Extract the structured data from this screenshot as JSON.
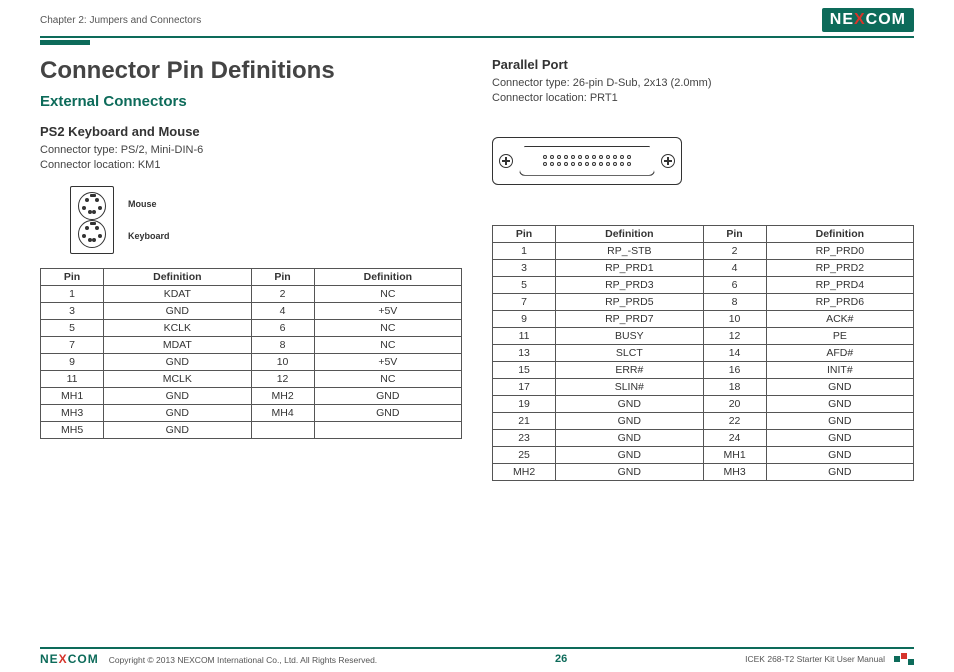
{
  "header": {
    "chapter": "Chapter 2: Jumpers and Connectors",
    "logo_text": "NEXCOM"
  },
  "page": {
    "title": "Connector Pin Definitions",
    "subheading": "External Connectors"
  },
  "ps2": {
    "heading": "PS2 Keyboard and Mouse",
    "type_line": "Connector type: PS/2, Mini-DIN-6",
    "loc_line": "Connector location: KM1",
    "label_mouse": "Mouse",
    "label_keyboard": "Keyboard",
    "headers": {
      "pin": "Pin",
      "def": "Definition"
    },
    "rows": [
      {
        "p1": "1",
        "d1": "KDAT",
        "p2": "2",
        "d2": "NC"
      },
      {
        "p1": "3",
        "d1": "GND",
        "p2": "4",
        "d2": "+5V"
      },
      {
        "p1": "5",
        "d1": "KCLK",
        "p2": "6",
        "d2": "NC"
      },
      {
        "p1": "7",
        "d1": "MDAT",
        "p2": "8",
        "d2": "NC"
      },
      {
        "p1": "9",
        "d1": "GND",
        "p2": "10",
        "d2": "+5V"
      },
      {
        "p1": "11",
        "d1": "MCLK",
        "p2": "12",
        "d2": "NC"
      },
      {
        "p1": "MH1",
        "d1": "GND",
        "p2": "MH2",
        "d2": "GND"
      },
      {
        "p1": "MH3",
        "d1": "GND",
        "p2": "MH4",
        "d2": "GND"
      },
      {
        "p1": "MH5",
        "d1": "GND",
        "p2": "",
        "d2": ""
      }
    ]
  },
  "parallel": {
    "heading": "Parallel Port",
    "type_line": "Connector type: 26-pin D-Sub, 2x13 (2.0mm)",
    "loc_line": "Connector location: PRT1",
    "headers": {
      "pin": "Pin",
      "def": "Definition"
    },
    "rows": [
      {
        "p1": "1",
        "d1": "RP_-STB",
        "p2": "2",
        "d2": "RP_PRD0"
      },
      {
        "p1": "3",
        "d1": "RP_PRD1",
        "p2": "4",
        "d2": "RP_PRD2"
      },
      {
        "p1": "5",
        "d1": "RP_PRD3",
        "p2": "6",
        "d2": "RP_PRD4"
      },
      {
        "p1": "7",
        "d1": "RP_PRD5",
        "p2": "8",
        "d2": "RP_PRD6"
      },
      {
        "p1": "9",
        "d1": "RP_PRD7",
        "p2": "10",
        "d2": "ACK#"
      },
      {
        "p1": "11",
        "d1": "BUSY",
        "p2": "12",
        "d2": "PE"
      },
      {
        "p1": "13",
        "d1": "SLCT",
        "p2": "14",
        "d2": "AFD#"
      },
      {
        "p1": "15",
        "d1": "ERR#",
        "p2": "16",
        "d2": "INIT#"
      },
      {
        "p1": "17",
        "d1": "SLIN#",
        "p2": "18",
        "d2": "GND"
      },
      {
        "p1": "19",
        "d1": "GND",
        "p2": "20",
        "d2": "GND"
      },
      {
        "p1": "21",
        "d1": "GND",
        "p2": "22",
        "d2": "GND"
      },
      {
        "p1": "23",
        "d1": "GND",
        "p2": "24",
        "d2": "GND"
      },
      {
        "p1": "25",
        "d1": "GND",
        "p2": "MH1",
        "d2": "GND"
      },
      {
        "p1": "MH2",
        "d1": "GND",
        "p2": "MH3",
        "d2": "GND"
      }
    ]
  },
  "footer": {
    "copyright": "Copyright © 2013 NEXCOM International Co., Ltd. All Rights Reserved.",
    "page_number": "26",
    "manual": "ICEK 268-T2 Starter Kit User Manual"
  }
}
